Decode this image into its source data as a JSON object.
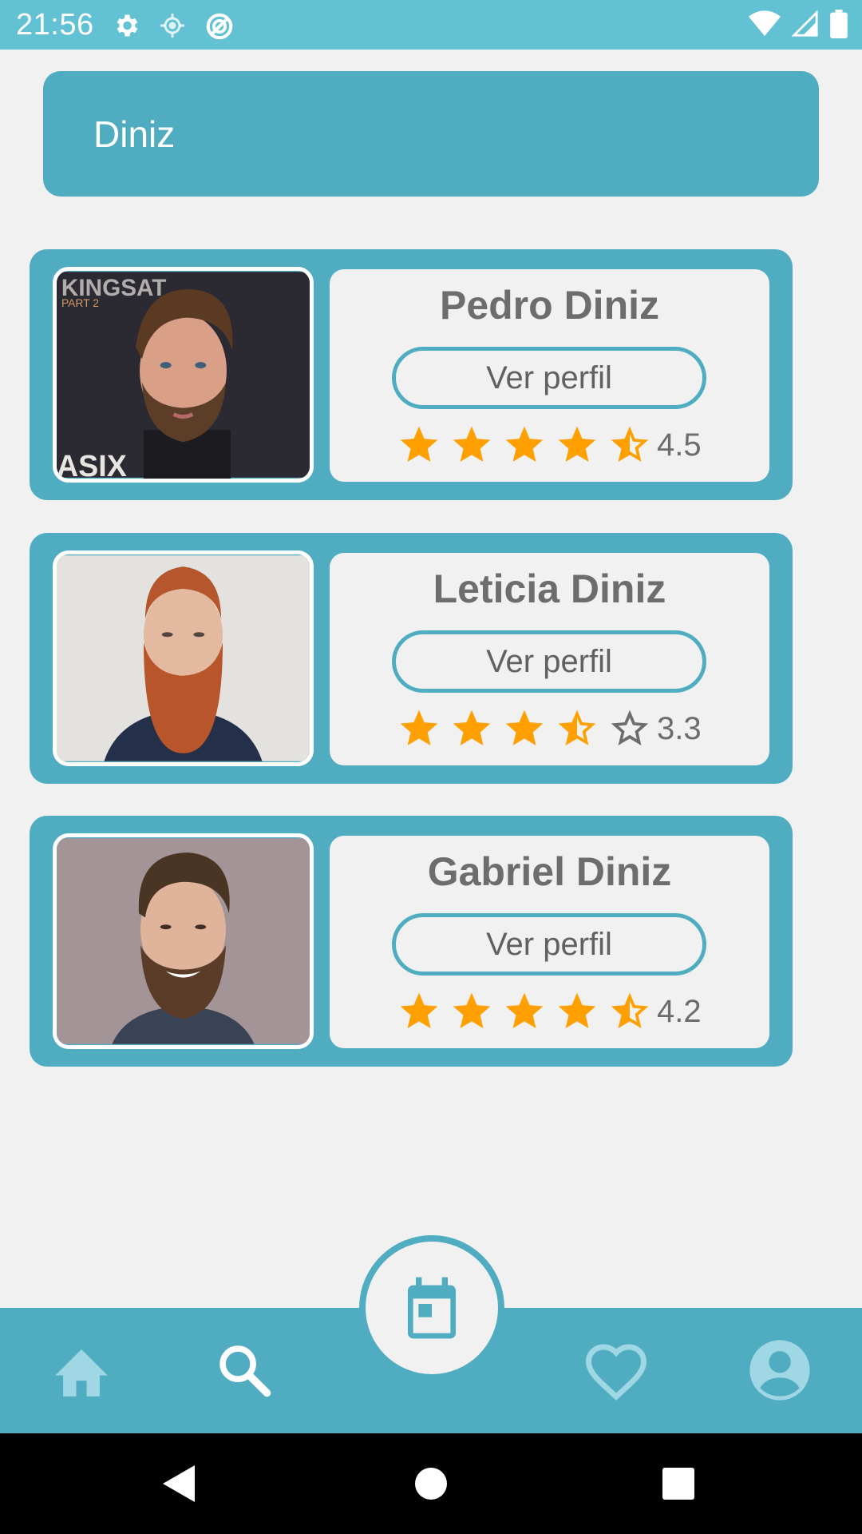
{
  "status_bar": {
    "time": "21:56",
    "left_icons": [
      "gear-icon",
      "location-icon",
      "sync-icon"
    ],
    "right_icons": [
      "wifi-icon",
      "signal-icon",
      "battery-icon"
    ]
  },
  "search": {
    "value": "Diniz"
  },
  "results": [
    {
      "name": "Pedro Diniz",
      "button_label": "Ver perfil",
      "rating": 4.5,
      "rating_label": "4.5",
      "photo": "man-dark-hair-beard-photo"
    },
    {
      "name": "Leticia Diniz",
      "button_label": "Ver perfil",
      "rating": 3.3,
      "rating_label": "3.3",
      "photo": "man-red-beard-photo"
    },
    {
      "name": "Gabriel Diniz",
      "button_label": "Ver perfil",
      "rating": 4.2,
      "rating_label": "4.2",
      "photo": "man-smiling-beard-photo"
    }
  ],
  "bottom_nav": {
    "items": [
      "home-icon",
      "search-icon",
      "calendar-icon",
      "heart-icon",
      "account-icon"
    ]
  },
  "system_nav": [
    "back-icon",
    "home-circle-icon",
    "recents-icon"
  ],
  "colors": {
    "primary": "#50adc1",
    "status_bar": "#62c1d2",
    "background": "#f1f1f1",
    "star": "#ffa000",
    "text": "#6d6d6d"
  }
}
